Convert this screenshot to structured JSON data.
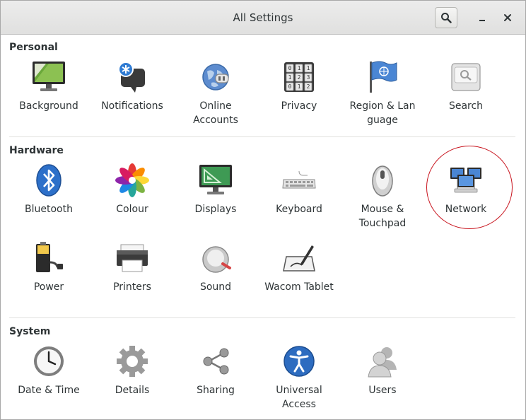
{
  "window": {
    "title": "All Settings"
  },
  "titlebar": {
    "search_icon": "search-icon",
    "minimize_icon": "minimize-icon",
    "close_icon": "close-icon"
  },
  "sections": {
    "personal": {
      "title": "Personal",
      "items": [
        {
          "label": "Background",
          "icon": "background-icon"
        },
        {
          "label": "Notifications",
          "icon": "notifications-icon"
        },
        {
          "label": "Online\nAccounts",
          "icon": "online-accounts-icon"
        },
        {
          "label": "Privacy",
          "icon": "privacy-icon"
        },
        {
          "label": "Region & Lan\nguage",
          "icon": "region-language-icon"
        },
        {
          "label": "Search",
          "icon": "search-icon"
        }
      ]
    },
    "hardware": {
      "title": "Hardware",
      "items": [
        {
          "label": "Bluetooth",
          "icon": "bluetooth-icon"
        },
        {
          "label": "Colour",
          "icon": "colour-icon"
        },
        {
          "label": "Displays",
          "icon": "displays-icon"
        },
        {
          "label": "Keyboard",
          "icon": "keyboard-icon"
        },
        {
          "label": "Mouse &\nTouchpad",
          "icon": "mouse-icon"
        },
        {
          "label": "Network",
          "icon": "network-icon"
        },
        {
          "label": "Power",
          "icon": "power-icon"
        },
        {
          "label": "Printers",
          "icon": "printer-icon"
        },
        {
          "label": "Sound",
          "icon": "sound-icon"
        },
        {
          "label": "Wacom Tablet",
          "icon": "wacom-tablet-icon"
        }
      ]
    },
    "system": {
      "title": "System",
      "items": [
        {
          "label": "Date & Time",
          "icon": "clock-icon"
        },
        {
          "label": "Details",
          "icon": "gear-icon"
        },
        {
          "label": "Sharing",
          "icon": "share-icon"
        },
        {
          "label": "Universal\nAccess",
          "icon": "accessibility-icon"
        },
        {
          "label": "Users",
          "icon": "users-icon"
        }
      ]
    }
  },
  "annotation": {
    "highlighted_item": "Network",
    "ring_color": "#c8141e"
  },
  "colors": {
    "title_text": "#2e3436",
    "window_bg": "#ffffff",
    "separator": "#e2e2e0"
  }
}
